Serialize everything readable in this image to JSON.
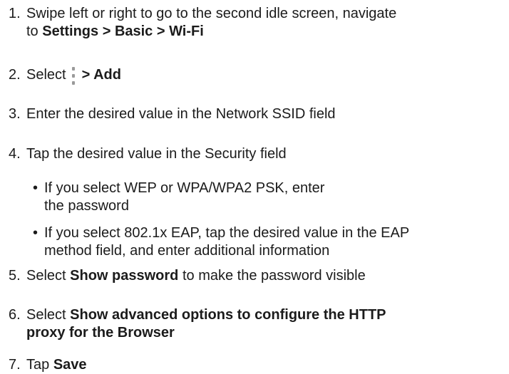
{
  "steps": [
    {
      "num": "1.",
      "line1": "Swipe left or right to go to the second idle screen, navigate",
      "to": "to ",
      "path": "Settings > Basic > Wi-Fi"
    },
    {
      "num": "2.",
      "pre": "Select",
      "icon": "kebab-menu-icon",
      "bold": "> Add"
    },
    {
      "num": "3.",
      "text": "Enter the desired value in the Network SSID field"
    },
    {
      "num": "4.",
      "text": "Tap the desired value in the Security field",
      "bullets": [
        {
          "dot": "•",
          "line1": "If you select WEP or WPA/WPA2 PSK, enter",
          "line2": "the password"
        },
        {
          "dot": "•",
          "line1": "If you select 802.1x EAP, tap the desired value in the EAP",
          "line2": "method field, and enter additional information"
        }
      ]
    },
    {
      "num": "5.",
      "pre": "Select ",
      "bold": "Show password",
      "post": " to make the password visible"
    },
    {
      "num": "6.",
      "pre": "Select ",
      "bold1": "Show advanced options to configure the HTTP",
      "bold2": "proxy for the Browser"
    },
    {
      "num": "7.",
      "pre": "Tap ",
      "bold": "Save"
    }
  ]
}
